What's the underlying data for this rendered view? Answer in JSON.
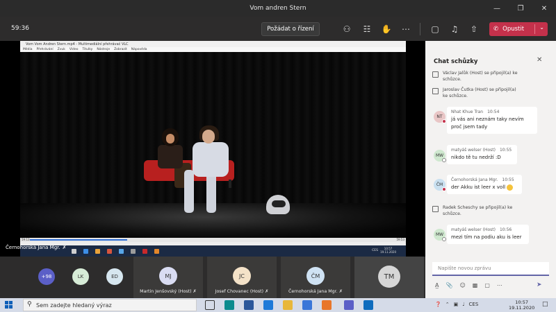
{
  "window": {
    "title": "Vom andren Stern",
    "controls": [
      "minimize-icon",
      "maximize-icon",
      "close-icon"
    ]
  },
  "toolbar": {
    "timer": "59:36",
    "request_control": "Požádat o řízení",
    "leave": "Opustit"
  },
  "vlc": {
    "title": "Vom Vom Andren Stern.mp4 - Multimediální přehrávač VLC",
    "menu": [
      "Média",
      "Přehrávání",
      "Zvuk",
      "Video",
      "Titulky",
      "Nástroje",
      "Zobrazit",
      "Nápověda"
    ],
    "time_elapsed": "59:13",
    "time_total": "59:53",
    "progress": 0.27,
    "taskbar_lang": "CES",
    "taskbar_time": "10:57",
    "taskbar_date": "19.11.2020"
  },
  "stage_caption": "Černohorská Jana Mgr.",
  "chat": {
    "title": "Chat schůzky",
    "system": [
      {
        "text": "Václav Jalůk (Host) se připojil(a) ke schůzce."
      },
      {
        "text": "Jaroslav Čutka (Host) se připojil(a) ke schůzce."
      },
      {
        "text": "Radek Scheschy se připojil(a) ke schůzce."
      }
    ],
    "messages": [
      {
        "initials": "NT",
        "author": "Nhat Khue Tran",
        "time": "10:54",
        "text": "já vás ani neznám taky nevím proč jsem tady",
        "color": "#e9c6c6"
      },
      {
        "initials": "MW",
        "author": "matyáš welser (Host)",
        "time": "10:55",
        "text": "nikdo tě tu nedrží :D",
        "color": "#cfe8cf"
      },
      {
        "initials": "ČM",
        "author": "Černohorská Jana Mgr.",
        "time": "10:55",
        "text": "der Akku ist leer x voll",
        "color": "#c9e0f0"
      },
      {
        "initials": "MW",
        "author": "matyáš welser (Host)",
        "time": "10:56",
        "text": "mezi tím na podiu aku is leer",
        "color": "#cfe8cf"
      }
    ],
    "composer_placeholder": "Napište novou zprávu"
  },
  "roster": {
    "overflow": "+98",
    "avatars": [
      {
        "initials": "LK",
        "color": "#d7ecd7"
      },
      {
        "initials": "ED",
        "color": "#d6e6ef"
      }
    ],
    "tiles": [
      {
        "initials": "MJ",
        "name": "Martin Jenšovský (Host)",
        "color": "#d9dcf2"
      },
      {
        "initials": "JC",
        "name": "Josef Chovanec (Host)",
        "color": "#f4e2c8"
      },
      {
        "initials": "ČM",
        "name": "Černohorská Jana Mgr.",
        "color": "#cfe2f3"
      },
      {
        "initials": "TM",
        "name": "",
        "color": "#d6d6d6"
      }
    ]
  },
  "taskbar": {
    "search_placeholder": "Sem zadejte hledaný výraz",
    "lang": "CES",
    "time": "10:57",
    "date": "19.11.2020"
  }
}
